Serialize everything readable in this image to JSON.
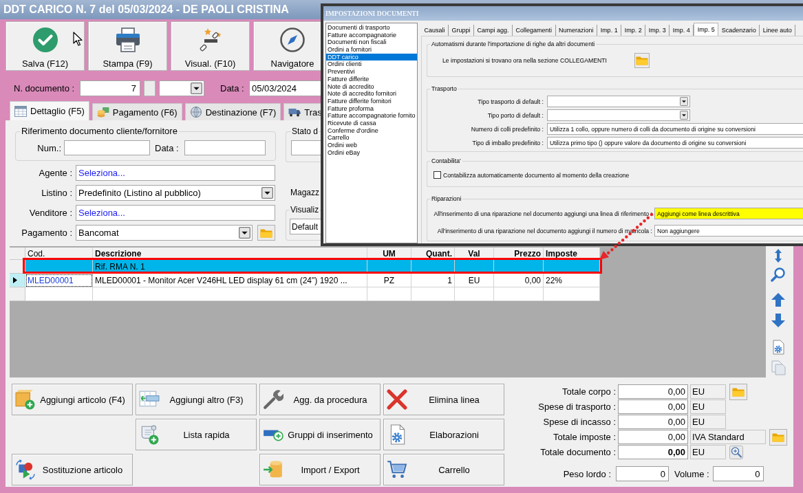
{
  "window": {
    "title": "DDT CARICO N. 7 del 05/03/2024 - DE PAOLI CRISTINA"
  },
  "toolbar": [
    {
      "label": "Salva (F12)"
    },
    {
      "label": "Stampa (F9)"
    },
    {
      "label": "Visual. (F10)"
    },
    {
      "label": "Navigatore"
    }
  ],
  "document": {
    "number_label": "N. documento :",
    "number": "7",
    "date_label": "Data :",
    "date": "05/03/2024"
  },
  "tabs": [
    {
      "label": "Dettaglio (F5)",
      "selected": true
    },
    {
      "label": "Pagamento (F6)",
      "selected": false
    },
    {
      "label": "Destinazione (F7)",
      "selected": false
    },
    {
      "label": "Tras",
      "selected": false
    }
  ],
  "reference": {
    "title": "Riferimento documento cliente/fornitore",
    "number_label": "Num.:",
    "date_label": "Data :"
  },
  "status_group": {
    "title": "Stato d"
  },
  "fields": [
    {
      "kind": "link",
      "label": "Agente :",
      "value": "Seleziona...",
      "folder": false
    },
    {
      "kind": "dropdown",
      "label": "Listino :",
      "value": "Predefinito (Listino al pubblico)",
      "folder": false
    },
    {
      "kind": "link",
      "label": "Venditore :",
      "value": "Seleziona...",
      "folder": false
    },
    {
      "kind": "dropdown",
      "label": "Pagamento :",
      "value": "Bancomat",
      "folder": true
    }
  ],
  "warehouse": {
    "label": "Magazz"
  },
  "view_group": {
    "title": "Visualiz",
    "value": "Default"
  },
  "table": {
    "columns": [
      {
        "label": "Cod.",
        "bold": false
      },
      {
        "label": "Descrizione",
        "bold": true
      },
      {
        "label": "UM",
        "bold": true
      },
      {
        "label": "Quant.",
        "bold": true
      },
      {
        "label": "Val",
        "bold": true
      },
      {
        "label": "Prezzo",
        "bold": true
      },
      {
        "label": "Imposte",
        "bold": true
      }
    ],
    "rows": [
      {
        "selected": true,
        "current": false,
        "highlighted": true,
        "descrizione": "Rif. RMA N. 1"
      },
      {
        "selected": false,
        "current": true,
        "highlighted": false,
        "cod": "MLED00001",
        "descrizione": "MLED00001 - Monitor Acer V246HL LED display 61 cm (24\") 1920 ...",
        "um": "PZ",
        "quant": "1",
        "val": "EU",
        "prezzo": "0,00",
        "imposte": "22%"
      }
    ]
  },
  "actions": [
    {
      "label": "Aggiungi articolo (F4)"
    },
    {
      "label": "Aggiungi altro (F3)"
    },
    {
      "label": "Agg. da procedura"
    },
    {
      "label": "Elimina linea"
    },
    {
      "label": "Lista rapida"
    },
    {
      "label": "Gruppi di inserimento"
    },
    {
      "label": "Elaborazioni"
    },
    {
      "label": "Sostituzione articolo"
    },
    {
      "label": "Import / Export"
    },
    {
      "label": "Carrello"
    }
  ],
  "totals": [
    {
      "kind": "folder",
      "label": "Totale corpo :",
      "value": "0,00",
      "unit": "EU",
      "bold": false
    },
    {
      "kind": "plain",
      "label": "Spese di trasporto :",
      "value": "0,00",
      "unit": "EU",
      "bold": false
    },
    {
      "kind": "plain",
      "label": "Spese di incasso :",
      "value": "0,00",
      "unit": "EU",
      "bold": false
    },
    {
      "kind": "folder",
      "label": "Totale imposte :",
      "value": "0,00",
      "unit": "IVA Standard",
      "bold": false
    },
    {
      "kind": "zoom",
      "label": "Totale documento :",
      "value": "0,00",
      "unit": "EU",
      "bold": true
    }
  ],
  "measures": [
    {
      "label": "Peso lordo :",
      "value": "0"
    },
    {
      "label": "Volume :",
      "value": "0"
    }
  ],
  "dialog": {
    "title": "IMPOSTAZIONI DOCUMENTI",
    "document_types": [
      {
        "label": "Documenti di trasporto",
        "selected": false
      },
      {
        "label": "Fatture accompagnatorie",
        "selected": false
      },
      {
        "label": "Documenti non fiscali",
        "selected": false
      },
      {
        "label": "Ordini a fornitori",
        "selected": false
      },
      {
        "label": "DDT carico",
        "selected": true
      },
      {
        "label": "Ordini clienti",
        "selected": false
      },
      {
        "label": "Preventivi",
        "selected": false
      },
      {
        "label": "Fatture differite",
        "selected": false
      },
      {
        "label": "Note di accredito",
        "selected": false
      },
      {
        "label": "Note di accredito fornitori",
        "selected": false
      },
      {
        "label": "Fatture differite fornitori",
        "selected": false
      },
      {
        "label": "Fatture proforma",
        "selected": false
      },
      {
        "label": "Fatture accompagnatorie fornito",
        "selected": false
      },
      {
        "label": "Ricevute di cassa",
        "selected": false
      },
      {
        "label": "Conferme d'ordine",
        "selected": false
      },
      {
        "label": "Carrello",
        "selected": false
      },
      {
        "label": "Ordini web",
        "selected": false
      },
      {
        "label": "Ordini eBay",
        "selected": false
      }
    ],
    "tabs": [
      {
        "label": "Causali",
        "selected": false
      },
      {
        "label": "Gruppi",
        "selected": false
      },
      {
        "label": "Campi agg.",
        "selected": false
      },
      {
        "label": "Collegamenti",
        "selected": false
      },
      {
        "label": "Numerazioni",
        "selected": false
      },
      {
        "label": "Imp. 1",
        "selected": false
      },
      {
        "label": "Imp. 2",
        "selected": false
      },
      {
        "label": "Imp. 3",
        "selected": false
      },
      {
        "label": "Imp. 4",
        "selected": false
      },
      {
        "label": "Imp. 5",
        "selected": true
      },
      {
        "label": "Scadenzario",
        "selected": false
      },
      {
        "label": "Linee auto",
        "selected": false
      }
    ],
    "import_group": {
      "title": "Automatismi durante l'importazione di righe da altri documenti",
      "text": "Le impostazioni si trovano ora nella sezione COLLEGAMENTI"
    },
    "transport_group": {
      "title": "Trasporto",
      "fields": [
        {
          "kind": "dropdown",
          "label": "Tipo trasporto di default :"
        },
        {
          "kind": "dropdown",
          "label": "Tipo porto di default :"
        },
        {
          "kind": "text",
          "label": "Numero di colli predefinito :",
          "value": "Utilizza 1 collo, oppure numero di colli da documento di origine su conversioni"
        },
        {
          "kind": "text",
          "label": "Tipo di imballo predefinito :",
          "value": "Utilizza primo tipo () oppure valore da documento di origine su conversioni"
        }
      ]
    },
    "accounting_group": {
      "title": "Contabilita'",
      "checkbox": {
        "label": "Contabilizza automaticamente documento al momento della creazione",
        "checked": false
      }
    },
    "repairs_group": {
      "title": "Riparazioni",
      "fields": [
        {
          "label": "All'inserimento di una riparazione nel documento aggiungi una linea di riferimento :",
          "value": "Aggiungi come linea descrittiva",
          "highlighted": true
        },
        {
          "label": "All'inserimento di una riparazione nel documento aggiungi il numero di matricola :",
          "value": "Non aggiungere",
          "highlighted": false
        }
      ]
    }
  }
}
